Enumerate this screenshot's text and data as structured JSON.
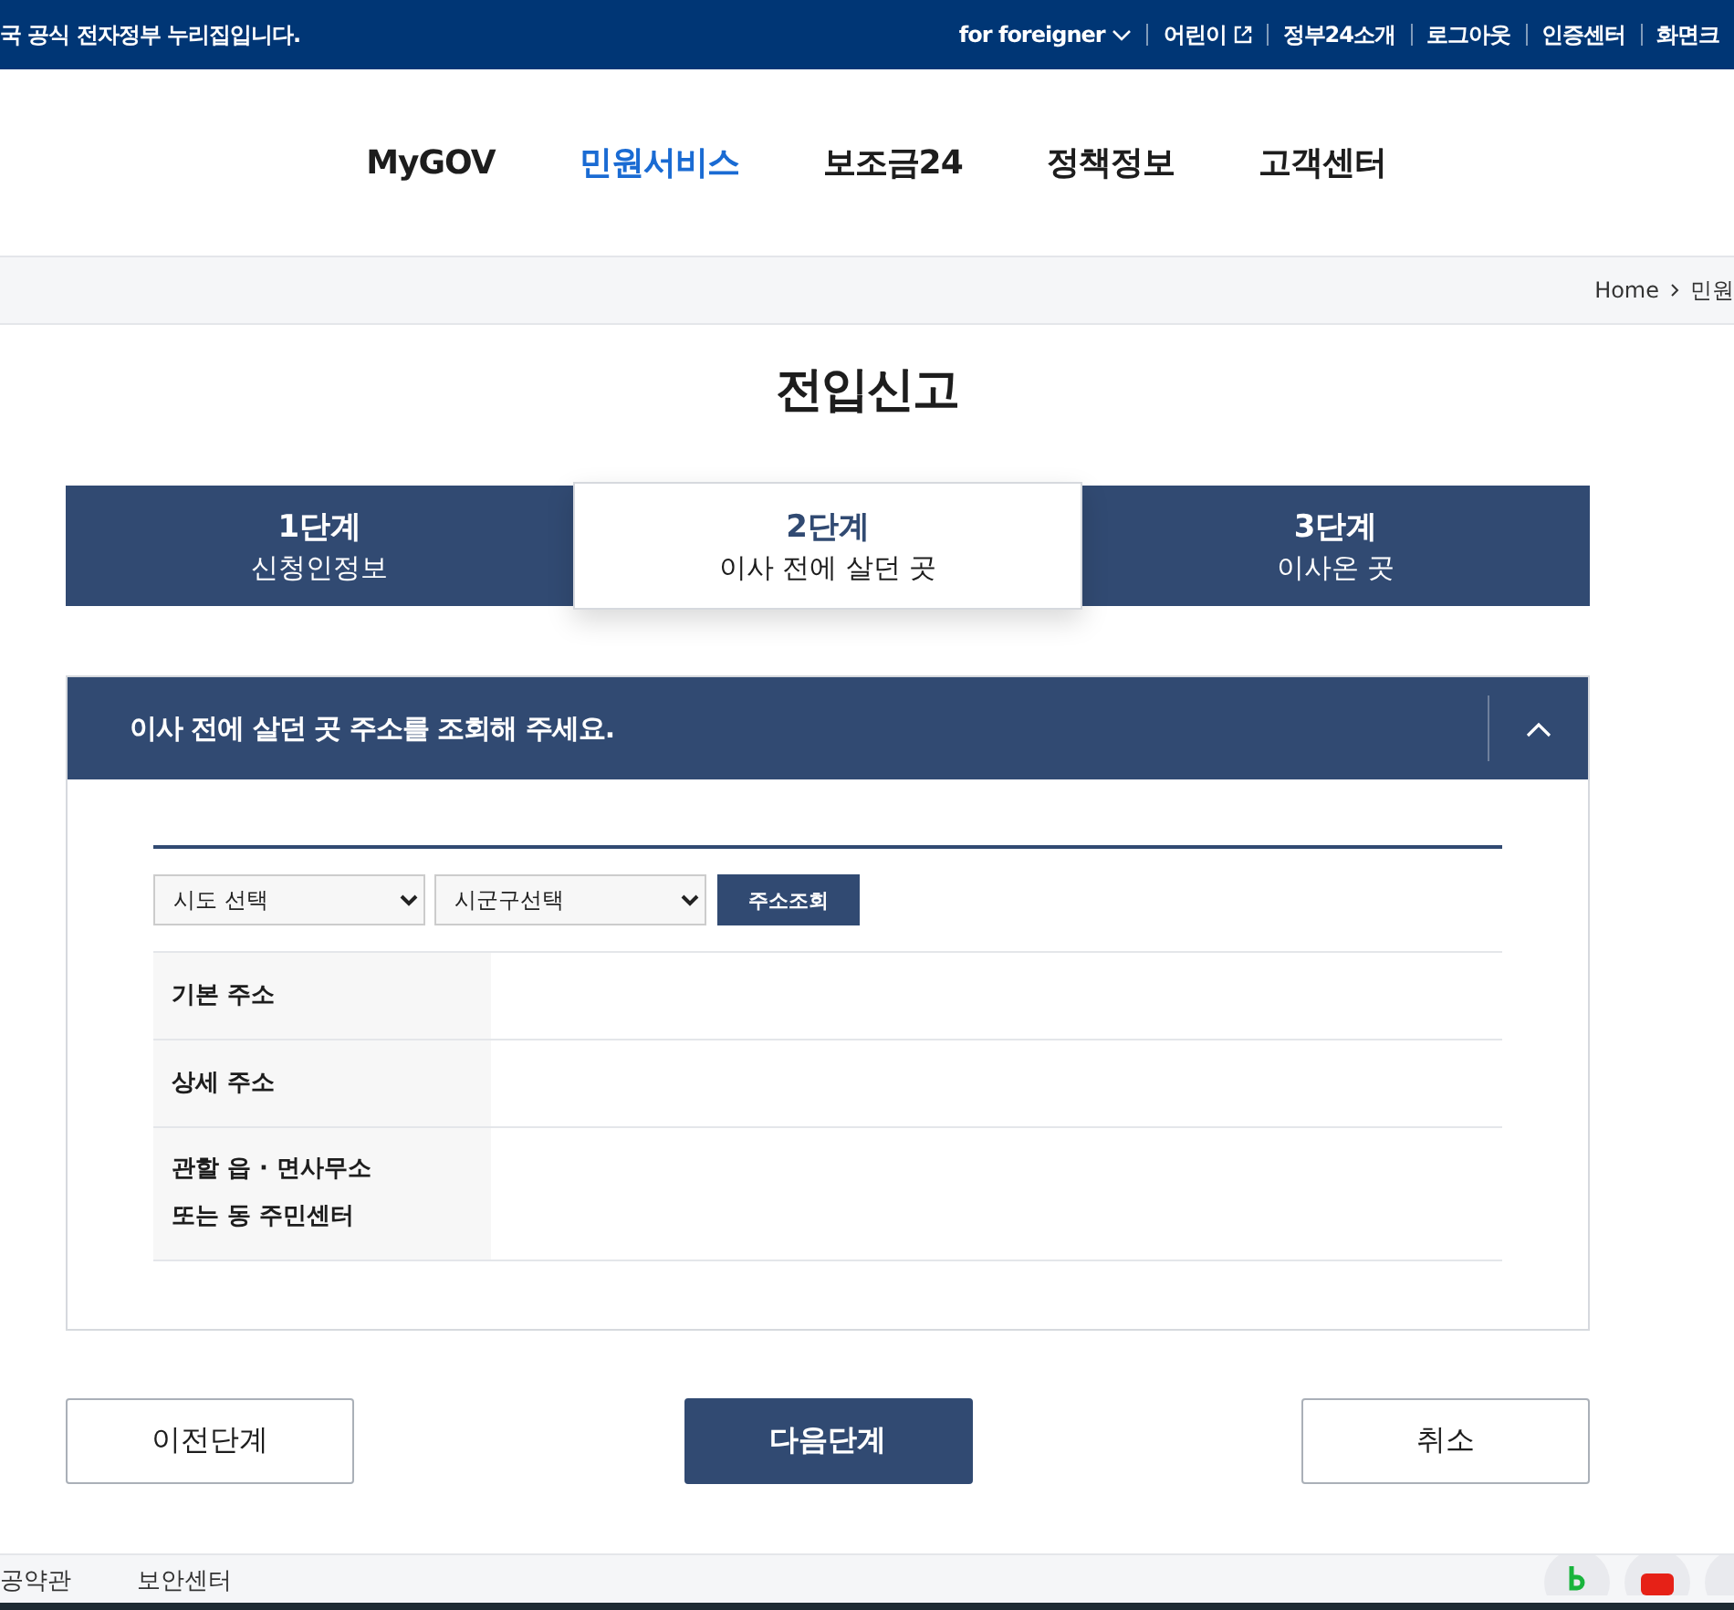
{
  "top_bar": {
    "notice": "국 공식 전자정부 누리집입니다.",
    "links": [
      {
        "label": "for foreigner",
        "kind": "dropdown"
      },
      {
        "label": "어린이",
        "kind": "external"
      },
      {
        "label": "정부24소개",
        "kind": "plain"
      },
      {
        "label": "로그아웃",
        "kind": "plain"
      },
      {
        "label": "인증센터",
        "kind": "plain"
      },
      {
        "label": "화면크",
        "kind": "plain"
      }
    ]
  },
  "nav": [
    {
      "label": "MyGOV",
      "selected": false
    },
    {
      "label": "민원서비스",
      "selected": true
    },
    {
      "label": "보조금24",
      "selected": false
    },
    {
      "label": "정책정보",
      "selected": false
    },
    {
      "label": "고객센터",
      "selected": false
    }
  ],
  "breadcrumb": [
    "Home",
    "민원"
  ],
  "title": "전입신고",
  "steps": [
    {
      "step": "1단계",
      "label": "신청인정보",
      "selected": false
    },
    {
      "step": "2단계",
      "label": "이사 전에 살던 곳",
      "selected": true
    },
    {
      "step": "3단계",
      "label": "이사온 곳",
      "selected": false
    }
  ],
  "panel": {
    "heading": "이사 전에 살던 곳 주소를 조회해 주세요.",
    "expanded": true,
    "selects": [
      {
        "value": "시도 선택"
      },
      {
        "value": "시군구선택"
      }
    ],
    "search_button": "주소조회",
    "rows": [
      {
        "label": [
          "기본 주소"
        ]
      },
      {
        "label": [
          "상세 주소"
        ]
      },
      {
        "label": [
          "관할 읍 · 면사무소",
          "또는 동 주민센터"
        ]
      }
    ]
  },
  "buttons": [
    {
      "label": "이전단계",
      "kind": "secondary"
    },
    {
      "label": "다음단계",
      "kind": "primary"
    },
    {
      "label": "취소",
      "kind": "secondary"
    }
  ],
  "footer": {
    "links": [
      "공약관",
      "보안센터"
    ]
  }
}
